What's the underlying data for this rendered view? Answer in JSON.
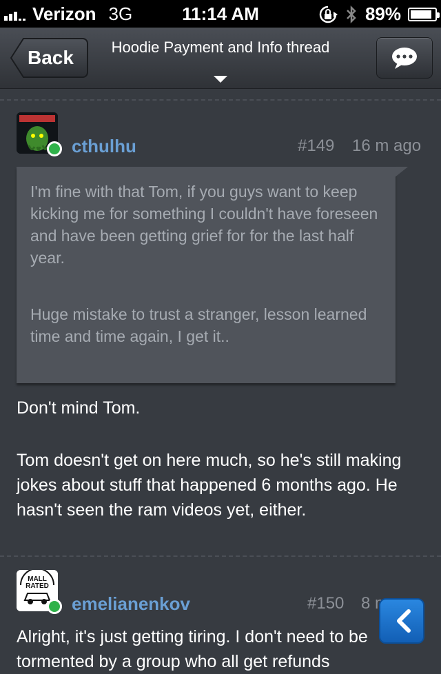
{
  "status_bar": {
    "carrier": "Verizon",
    "network": "3G",
    "time": "11:14 AM",
    "battery": "89%",
    "battery_level": 0.89
  },
  "nav": {
    "back_label": "Back",
    "title": "Hoodie Payment and Info thread"
  },
  "posts": [
    {
      "username": "cthulhu",
      "number": "#149",
      "time": "16 m ago",
      "quote_paragraphs": [
        "I'm fine with that Tom, if you guys want to keep kicking me for something I couldn't have foreseen and have been getting grief for for the last half year.",
        "Huge mistake to trust a stranger, lesson learned time and time again, I get it.."
      ],
      "body_paragraphs": [
        "Don't mind Tom.",
        "Tom doesn't get on here much, so he's still making jokes about stuff that happened 6 months ago. He hasn't seen the ram videos yet, either."
      ]
    },
    {
      "username": "emelianenkov",
      "avatar_text": "MALL RATED",
      "number": "#150",
      "time": "8 m",
      "body_paragraphs": [
        "Alright, it's just getting tiring. I don't need to be tormented by a group who all get refunds"
      ]
    }
  ]
}
